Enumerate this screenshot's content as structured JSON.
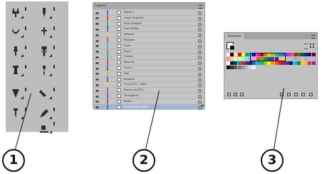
{
  "layers_panel": {
    "title": "Layers",
    "rows": [
      {
        "name": "Ebene 1",
        "color": "#4a6cd4",
        "expanded": false,
        "selected": false
      },
      {
        "name": "Guide Graphics",
        "color": "#d44a4a",
        "expanded": false,
        "selected": false
      },
      {
        "name": "Face Graphics",
        "color": "#4ab54a",
        "expanded": false,
        "selected": false
      },
      {
        "name": "Line Hiding",
        "color": "#4a6cd4",
        "expanded": false,
        "selected": false
      },
      {
        "name": "Artwork",
        "color": "#d4d44a",
        "expanded": false,
        "selected": false
      },
      {
        "name": "Register",
        "color": "#c44ac4",
        "expanded": false,
        "selected": false
      },
      {
        "name": "Draw",
        "color": "#4ac4c4",
        "expanded": false,
        "selected": false
      },
      {
        "name": "Score",
        "color": "#8a8a8a",
        "expanded": false,
        "selected": false
      },
      {
        "name": "Crease",
        "color": "#4ab54a",
        "expanded": true,
        "selected": false
      },
      {
        "name": "Kiss-cut",
        "color": "#d44a4a",
        "expanded": false,
        "selected": false
      },
      {
        "name": "Punch",
        "color": "#4a6cd4",
        "expanded": false,
        "selected": false
      },
      {
        "name": "Drill",
        "color": "#d4a84a",
        "expanded": false,
        "selected": false
      },
      {
        "name": "Engrave",
        "color": "#8a4ad4",
        "expanded": false,
        "selected": false
      },
      {
        "name": "V-cut [30° / -3Ne]",
        "color": "#d4d44a",
        "expanded": false,
        "selected": false
      },
      {
        "name": "Bevel-cut [45°]",
        "color": "#c44ac4",
        "expanded": false,
        "selected": false
      },
      {
        "name": "Throughcut",
        "color": "#4a6cd4",
        "expanded": true,
        "selected": false
      },
      {
        "name": "Route",
        "color": "#d44a4a",
        "expanded": false,
        "selected": false
      },
      {
        "name": "3D Structure Hatch",
        "color": "#4a6cd4",
        "expanded": false,
        "selected": true
      }
    ]
  },
  "swatches_panel": {
    "tab_label": "Farbfelder",
    "swatch_colors": [
      [
        "#ffffff",
        "#000000",
        "#e8e8e8",
        "#ff0000",
        "#ffff00",
        "#00b050",
        "#00b0f0",
        "#0000ff",
        "#ff00ff",
        "#c00000",
        "#ff6600",
        "#ffcc00",
        "#99cc00",
        "#00cc99",
        "#0099cc",
        "#3366ff",
        "#9933ff",
        "#ff3399",
        "#993300",
        "#666600",
        "#006633",
        "#003366",
        "#330066",
        "#660033"
      ],
      [
        "#ff9999",
        "#ffcc99",
        "#ffff99",
        "#ccff99",
        "#99ffcc",
        "#99ccff",
        "#cc99ff",
        "#ff99cc",
        "#cc6600",
        "#999900",
        "#009966",
        "#006699",
        "#663399",
        "#990066",
        "#f4b183",
        "#ffd966",
        "#a9d18e",
        "#9dc3e6",
        "#8faadc",
        "#c9a0dc",
        "#e6b8af",
        "#b4a7d6",
        "#a2c4c9",
        "#d5a6bd"
      ],
      [
        "#ffffff",
        "#1a1a1a",
        "#0033cc",
        "#00a651",
        "#ed1c24",
        "#2e3192",
        "#262262",
        "#0072bc",
        "#00aeef",
        "#39b54a",
        "#8dc63f",
        "#fff200",
        "#f7941d",
        "#f15a24",
        "#c1272d",
        "#9e1f63",
        "#662d91",
        "#1b1464",
        "#29abe2",
        "#009245",
        "#d9e021",
        "#fbb03b",
        "#ed1e79",
        "#93278f"
      ],
      [
        "#111111",
        "#333333",
        "#555555",
        "#777777",
        "#999999",
        "#bbbbbb",
        "#dddddd",
        "#f2f2f2"
      ]
    ]
  },
  "callouts": [
    "1",
    "2",
    "3"
  ]
}
